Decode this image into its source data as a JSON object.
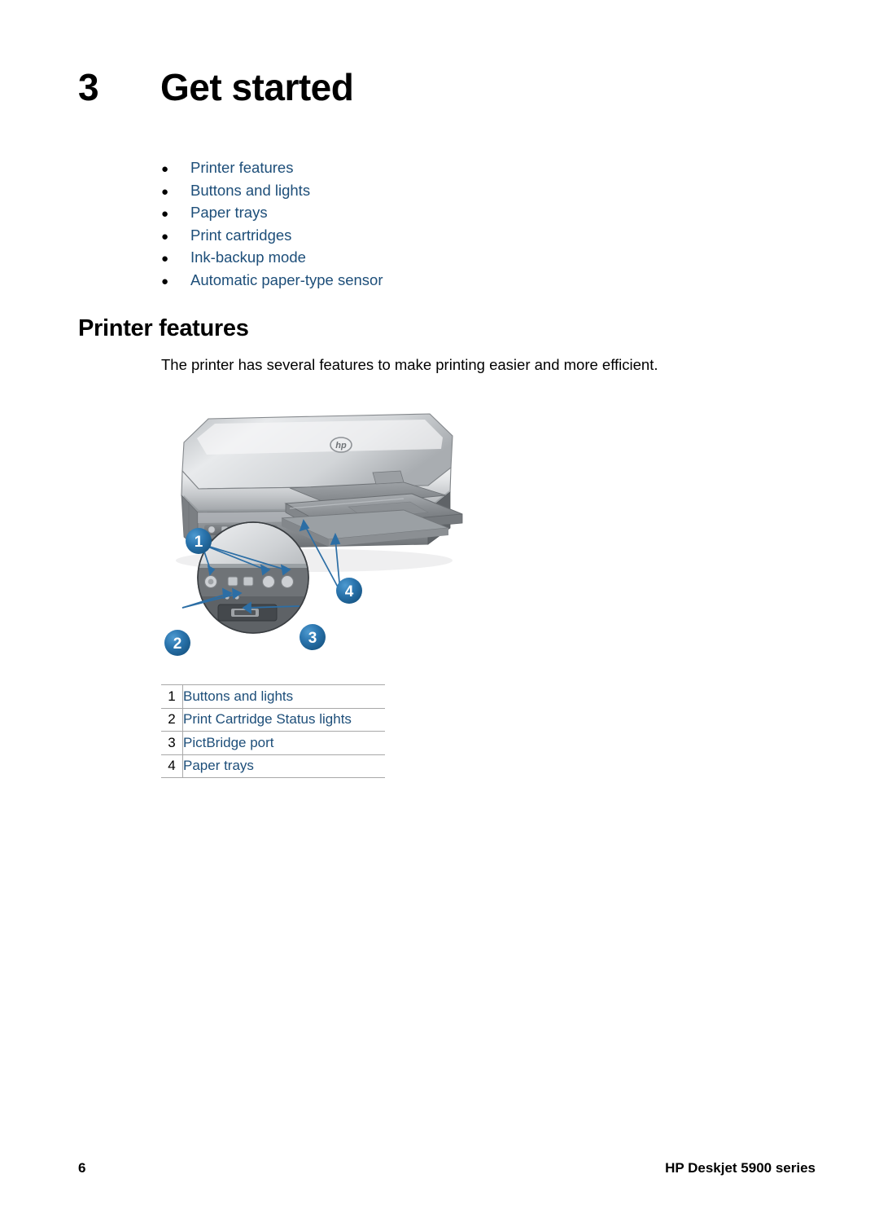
{
  "document": {
    "chapter": {
      "number": "3",
      "title": "Get started"
    },
    "toc": {
      "bullet_glyph": "●",
      "items": [
        {
          "label": "Printer features"
        },
        {
          "label": "Buttons and lights"
        },
        {
          "label": "Paper trays"
        },
        {
          "label": "Print cartridges"
        },
        {
          "label": "Ink-backup mode"
        },
        {
          "label": "Automatic paper-type sensor"
        }
      ]
    },
    "section": {
      "heading": "Printer features",
      "intro": "The printer has several features to make printing easier and more efficient."
    },
    "figure": {
      "alt": "HP Deskjet printer front view with magnified control panel inset",
      "callouts": [
        {
          "number": "1"
        },
        {
          "number": "2"
        },
        {
          "number": "3"
        },
        {
          "number": "4"
        }
      ],
      "colors": {
        "callout_dark": "#1b5f92",
        "callout_light": "#3f8ec4",
        "arrow": "#2c6ea5",
        "printer_body_light": "#d8dadc",
        "printer_body_mid": "#a8abae",
        "printer_body_dark": "#6d7276",
        "printer_panel_dark": "#55595d"
      }
    },
    "legend": {
      "rows": [
        {
          "number": "1",
          "label": "Buttons and lights"
        },
        {
          "number": "2",
          "label": "Print Cartridge Status lights"
        },
        {
          "number": "3",
          "label": "PictBridge port"
        },
        {
          "number": "4",
          "label": "Paper trays"
        }
      ]
    },
    "footer": {
      "page_number": "6",
      "product_name": "HP Deskjet 5900 series"
    },
    "colors": {
      "link_blue": "#1d4e79",
      "rule_gray": "#a8a8a8",
      "text_black": "#000000",
      "page_background": "#ffffff"
    }
  }
}
